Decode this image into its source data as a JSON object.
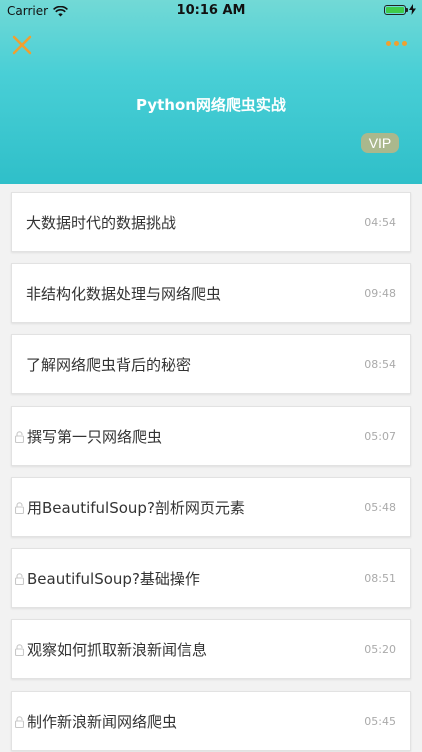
{
  "status_bar": {
    "carrier": "Carrier",
    "time": "10:16 AM"
  },
  "header": {
    "title": "Python网络爬虫实战",
    "vip_label": "VIP"
  },
  "lessons": [
    {
      "title": "大数据时代的数据挑战",
      "duration": "04:54",
      "locked": false
    },
    {
      "title": "非结构化数据处理与网络爬虫",
      "duration": "09:48",
      "locked": false
    },
    {
      "title": "了解网络爬虫背后的秘密",
      "duration": "08:54",
      "locked": false
    },
    {
      "title": "撰写第一只网络爬虫",
      "duration": "05:07",
      "locked": true
    },
    {
      "title": "用BeautifulSoup?剖析网页元素",
      "duration": "05:48",
      "locked": true
    },
    {
      "title": "BeautifulSoup?基础操作",
      "duration": "08:51",
      "locked": true
    },
    {
      "title": "观察如何抓取新浪新闻信息",
      "duration": "05:20",
      "locked": true
    },
    {
      "title": "制作新浪新闻网络爬虫",
      "duration": "05:45",
      "locked": true
    }
  ],
  "colors": {
    "accent": "#f0a030",
    "header_top": "#72d9d6",
    "header_bottom": "#2fbfc9",
    "vip_bg": "#aab88d"
  },
  "icons": [
    "wifi-icon",
    "battery-icon",
    "close-icon",
    "more-icon",
    "lock-icon"
  ]
}
